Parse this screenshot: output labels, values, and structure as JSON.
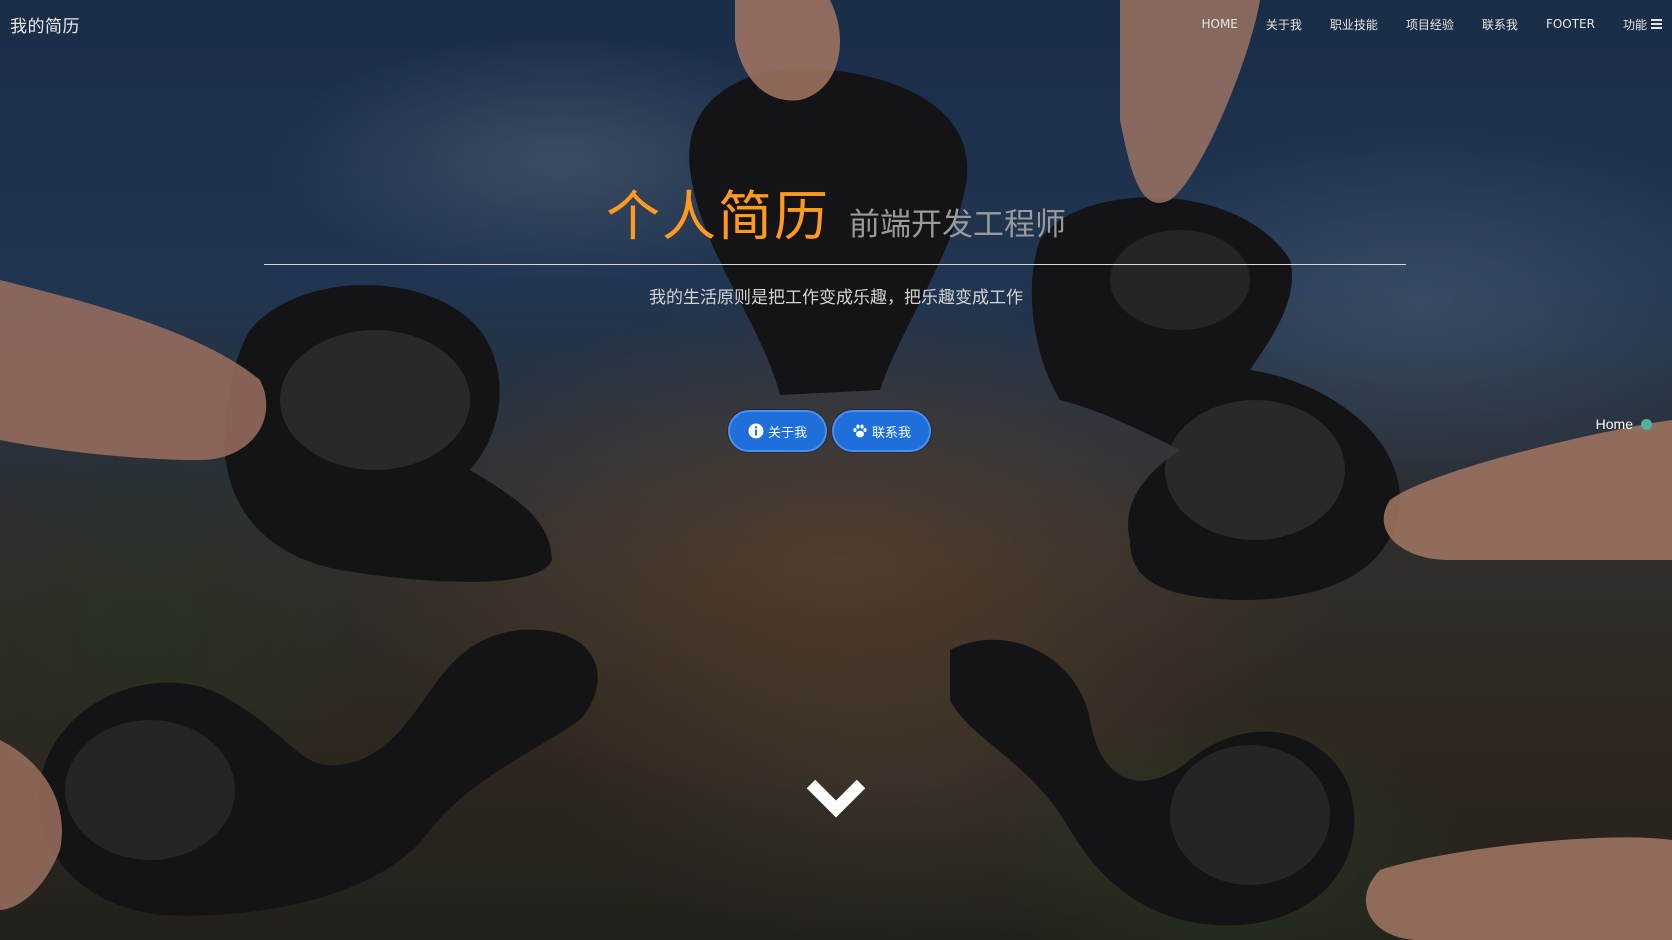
{
  "navbar": {
    "brand": "我的简历",
    "items": [
      {
        "label": "HOME"
      },
      {
        "label": "关于我"
      },
      {
        "label": "职业技能"
      },
      {
        "label": "项目经验"
      },
      {
        "label": "联系我"
      },
      {
        "label": "FOOTER"
      },
      {
        "label": "功能"
      }
    ],
    "menu_icon": "list-icon"
  },
  "hero": {
    "title": "个人简历",
    "subtitle": "前端开发工程师",
    "motto": "我的生活原则是把工作变成乐趣，把乐趣变成工作"
  },
  "buttons": {
    "about": {
      "label": "关于我",
      "icon": "info-circle-icon"
    },
    "contact": {
      "label": "联系我",
      "icon": "paw-icon"
    }
  },
  "section_indicator": {
    "label": "Home"
  },
  "scroll_icon": "chevron-down-icon",
  "colors": {
    "title": "#ff9a1f",
    "subtitle": "#9a9a9a",
    "button": "#1e6fd9",
    "indicator_dot": "#4fb3a0"
  }
}
